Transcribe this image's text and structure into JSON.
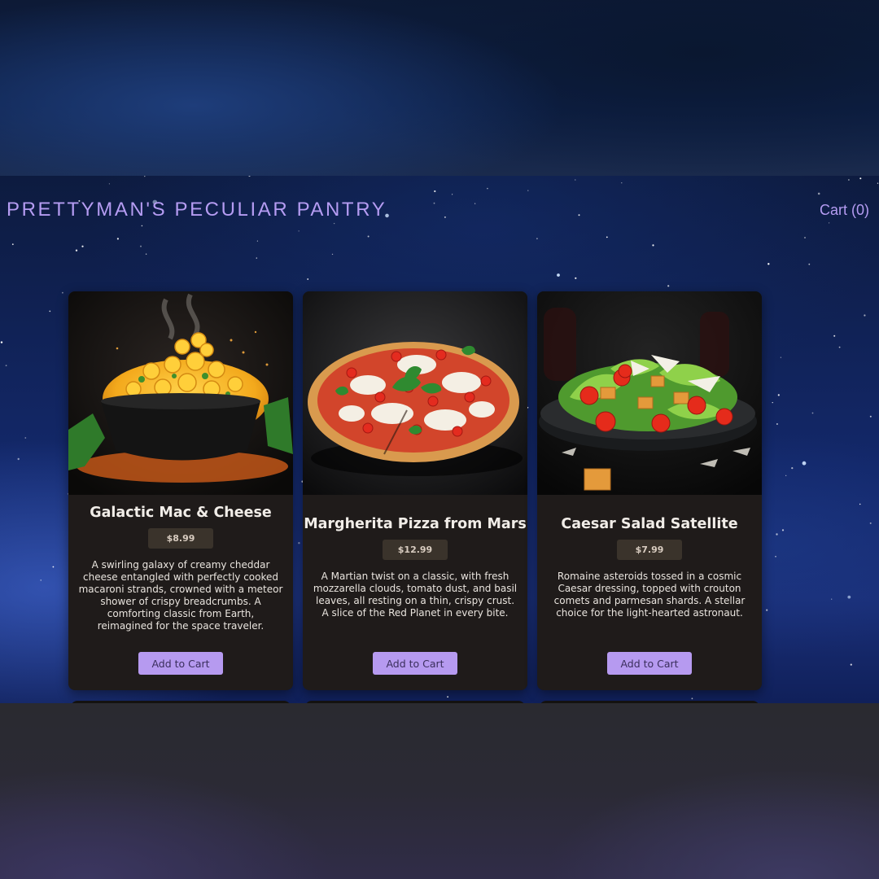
{
  "header": {
    "brand": "PRETTYMAN'S PECULIAR PANTRY",
    "cart_label": "Cart (0)"
  },
  "products": [
    {
      "name": "Galactic Mac & Cheese",
      "price": "$8.99",
      "description": "A swirling galaxy of creamy cheddar cheese entangled with perfectly cooked macaroni strands, crowned with a meteor shower of crispy breadcrumbs. A comforting classic from Earth, reimagined for the space traveler.",
      "image": "mac-and-cheese-bowl",
      "button": "Add to Cart"
    },
    {
      "name": "Margherita Pizza from Mars",
      "price": "$12.99",
      "description": "A Martian twist on a classic, with fresh mozzarella clouds, tomato dust, and basil leaves, all resting on a thin, crispy crust. A slice of the Red Planet in every bite.",
      "image": "margherita-pizza",
      "button": "Add to Cart"
    },
    {
      "name": "Caesar Salad Satellite",
      "price": "$7.99",
      "description": "Romaine asteroids tossed in a cosmic Caesar dressing, topped with crouton comets and parmesan shards. A stellar choice for the light-hearted astronaut.",
      "image": "caesar-salad-plate",
      "button": "Add to Cart"
    }
  ],
  "colors": {
    "accent": "#b59cf2",
    "button": "#b69af0",
    "card": "#1f1b1a",
    "price_badge": "#3a332b"
  }
}
